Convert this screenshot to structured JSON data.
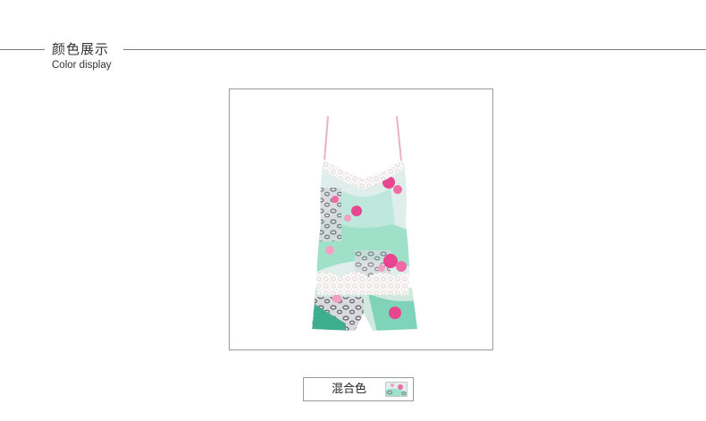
{
  "section": {
    "title_cn": "颜色展示",
    "title_en": "Color display"
  },
  "product_image": {
    "icon": "camisole-shorts-set-image",
    "palette": {
      "base": "#dfeeea",
      "mint": "#7fd3b8",
      "teal": "#3fae8e",
      "pink": "#e8458f",
      "light_pink": "#f3a0c4",
      "lace": "#f7f4f4",
      "leopard": "#6b6f74"
    }
  },
  "swatches": [
    {
      "label": "混合色",
      "icon": "mixed-color-swatch-icon"
    }
  ]
}
